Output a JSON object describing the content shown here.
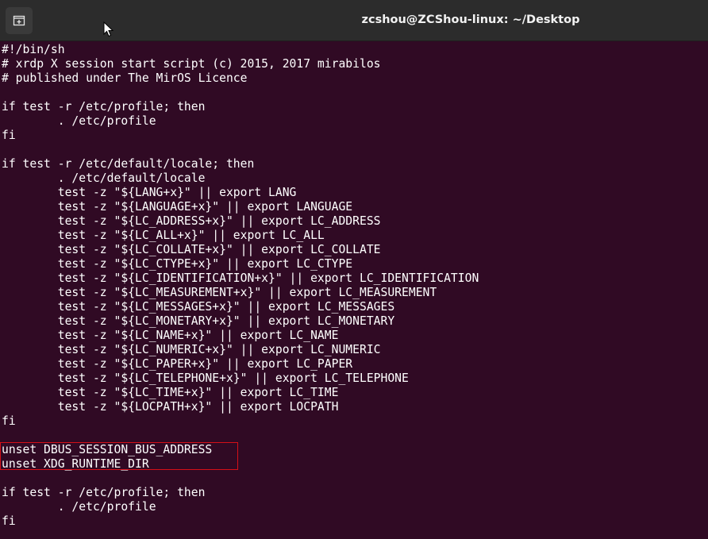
{
  "window": {
    "title": "zcshou@ZCShou-linux: ~/Desktop",
    "newtab_icon": "new-tab-icon",
    "cursor_icon": "mouse-pointer-icon"
  },
  "terminal": {
    "lines": [
      "#!/bin/sh",
      "# xrdp X session start script (c) 2015, 2017 mirabilos",
      "# published under The MirOS Licence",
      "",
      "if test -r /etc/profile; then",
      "        . /etc/profile",
      "fi",
      "",
      "if test -r /etc/default/locale; then",
      "        . /etc/default/locale",
      "        test -z \"${LANG+x}\" || export LANG",
      "        test -z \"${LANGUAGE+x}\" || export LANGUAGE",
      "        test -z \"${LC_ADDRESS+x}\" || export LC_ADDRESS",
      "        test -z \"${LC_ALL+x}\" || export LC_ALL",
      "        test -z \"${LC_COLLATE+x}\" || export LC_COLLATE",
      "        test -z \"${LC_CTYPE+x}\" || export LC_CTYPE",
      "        test -z \"${LC_IDENTIFICATION+x}\" || export LC_IDENTIFICATION",
      "        test -z \"${LC_MEASUREMENT+x}\" || export LC_MEASUREMENT",
      "        test -z \"${LC_MESSAGES+x}\" || export LC_MESSAGES",
      "        test -z \"${LC_MONETARY+x}\" || export LC_MONETARY",
      "        test -z \"${LC_NAME+x}\" || export LC_NAME",
      "        test -z \"${LC_NUMERIC+x}\" || export LC_NUMERIC",
      "        test -z \"${LC_PAPER+x}\" || export LC_PAPER",
      "        test -z \"${LC_TELEPHONE+x}\" || export LC_TELEPHONE",
      "        test -z \"${LC_TIME+x}\" || export LC_TIME",
      "        test -z \"${LOCPATH+x}\" || export LOCPATH",
      "fi",
      "",
      "unset DBUS_SESSION_BUS_ADDRESS",
      "unset XDG_RUNTIME_DIR",
      "",
      "if test -r /etc/profile; then",
      "        . /etc/profile",
      "fi"
    ]
  },
  "colors": {
    "terminal_bg": "#300a24",
    "titlebar_bg": "#2c2c2c",
    "text": "#ffffff",
    "highlight_border": "#d40f18"
  }
}
